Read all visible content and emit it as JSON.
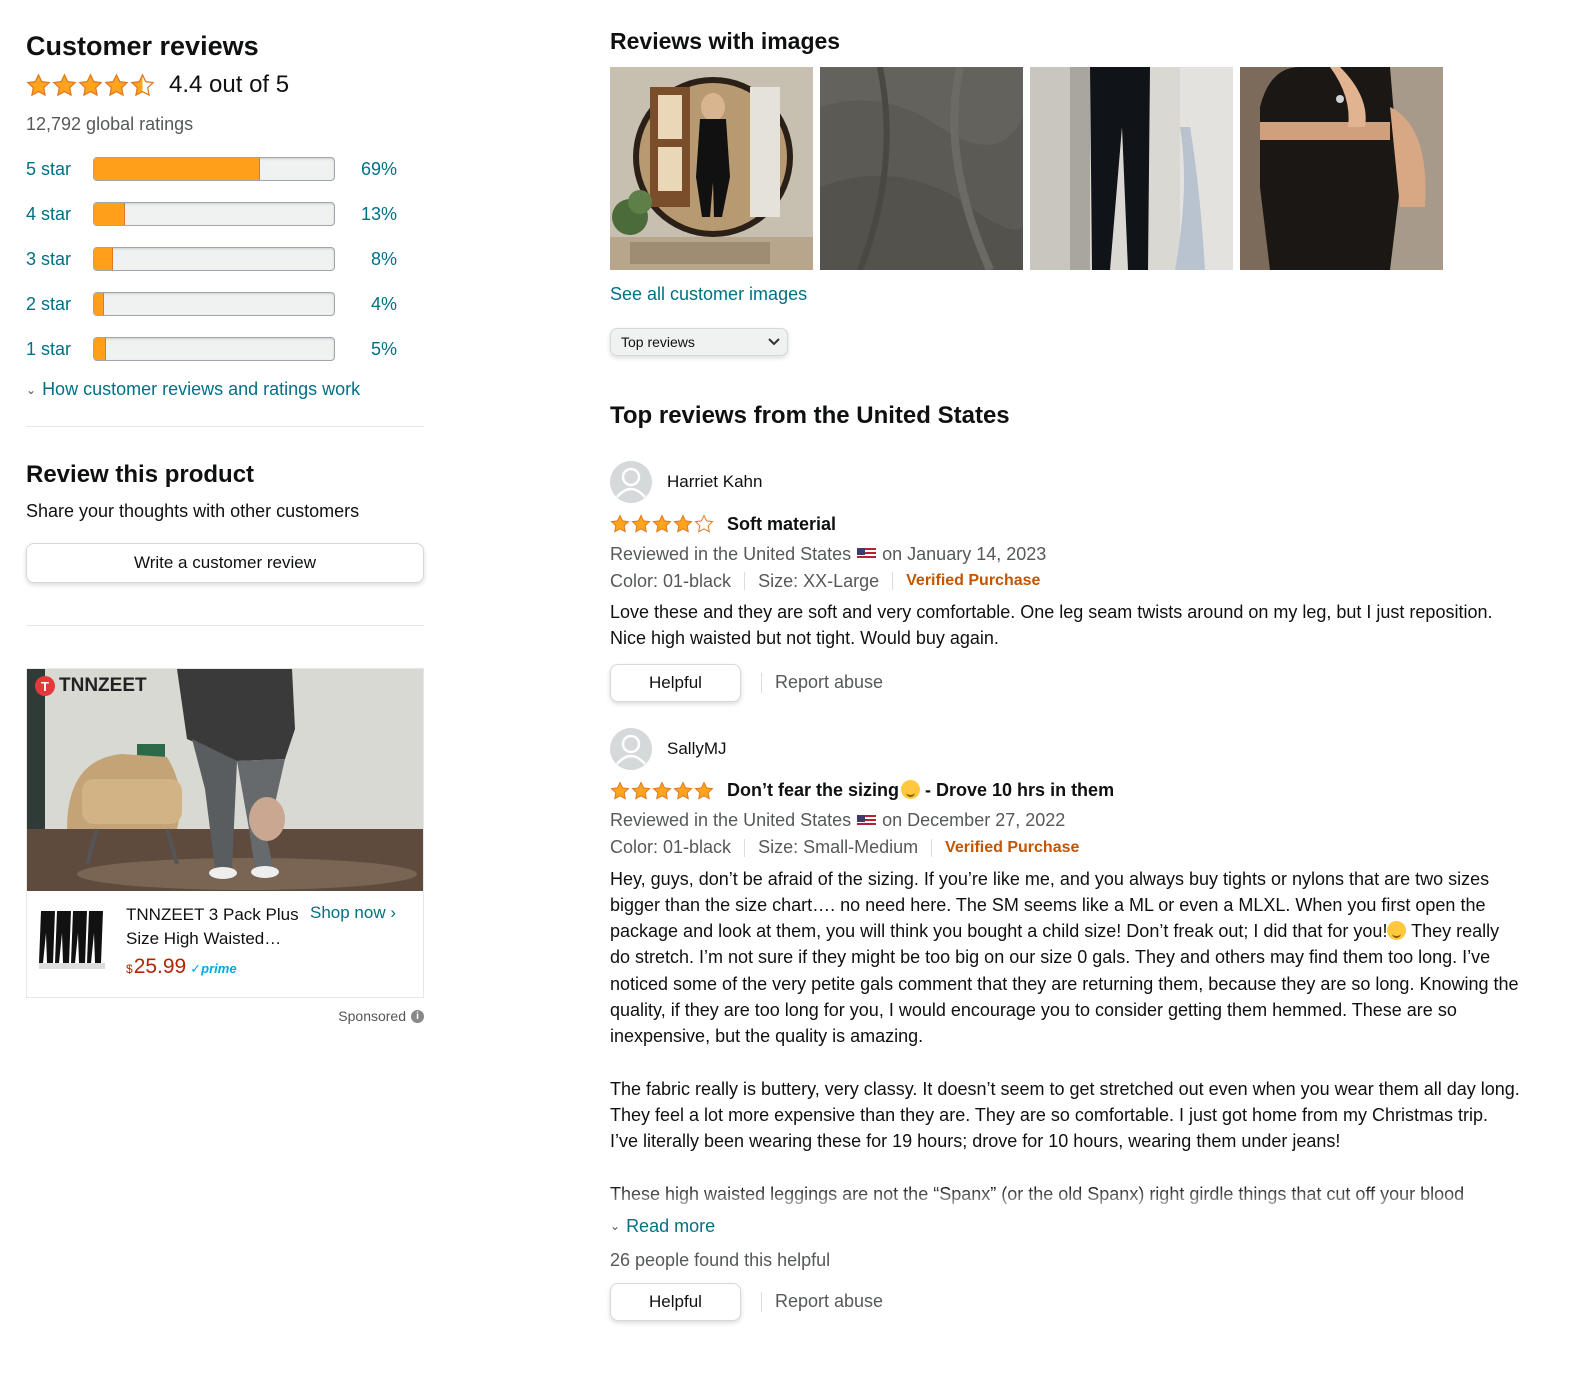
{
  "summary": {
    "heading": "Customer reviews",
    "average_text": "4.4 out of 5",
    "average_rating": 4.4,
    "global_ratings": "12,792 global ratings",
    "histogram": [
      {
        "label": "5 star",
        "pct_text": "69%",
        "pct": 69
      },
      {
        "label": "4 star",
        "pct_text": "13%",
        "pct": 13
      },
      {
        "label": "3 star",
        "pct_text": "8%",
        "pct": 8
      },
      {
        "label": "2 star",
        "pct_text": "4%",
        "pct": 4
      },
      {
        "label": "1 star",
        "pct_text": "5%",
        "pct": 5
      }
    ],
    "how_link": "How customer reviews and ratings work"
  },
  "review_this": {
    "heading": "Review this product",
    "subtext": "Share your thoughts with other customers",
    "button": "Write a customer review"
  },
  "ad": {
    "brand": "TNNZEET",
    "title": "TNNZEET 3 Pack Plus Size High Waisted…",
    "price_symbol": "$",
    "price": "25.99",
    "prime": "prime",
    "shop_now": "Shop now ›",
    "sponsored": "Sponsored"
  },
  "images_section": {
    "heading": "Reviews with images",
    "see_all": "See all customer images",
    "images": [
      "mirror-selfie-image",
      "gray-fabric-image",
      "black-leggings-image",
      "black-top-selfie-image"
    ]
  },
  "sort": {
    "selected": "Top reviews"
  },
  "top_heading": "Top reviews from the United States",
  "reviews": [
    {
      "name": "Harriet Kahn",
      "rating": 4,
      "title_part1": "Soft material",
      "title_part2": "",
      "reviewed_prefix": "Reviewed in the United States",
      "reviewed_date": "on January 14, 2023",
      "color": "Color: 01-black",
      "size": "Size: XX-Large",
      "verified": "Verified Purchase",
      "paragraphs": [
        "Love these and they are soft and very comfortable. One leg seam twists around on my leg, but I just reposition. Nice high waisted but not tight. Would buy again."
      ],
      "read_more": "",
      "found_helpful": "",
      "helpful_button": "Helpful",
      "report": "Report abuse"
    },
    {
      "name": "SallyMJ",
      "rating": 5,
      "title_part1": "Don’t fear the sizing",
      "title_part2": " - Drove 10 hrs in them",
      "reviewed_prefix": "Reviewed in the United States",
      "reviewed_date": "on December 27, 2022",
      "color": "Color: 01-black",
      "size": "Size: Small-Medium",
      "verified": "Verified Purchase",
      "paragraphs": [
        "Hey, guys, don’t be afraid of the sizing. If you’re like me, and you always buy tights or nylons that are two sizes bigger than the size chart…. no need here. The SM seems like a ML or even a MLXL. When you first open the package and look at them, you will think you bought a child size! Don’t freak out; I did that for you!😉 They really do stretch. I’m not sure if they might be too big on our size 0 gals. They and others may find them too long. I’ve noticed some of the very petite gals comment that they are returning them, because they are so long. Knowing the quality, if they are too long for you, I would encourage you to consider getting them hemmed. These are so inexpensive, but the quality is amazing.",
        "The fabric really is buttery, very classy. It doesn’t seem to get stretched out even when you wear them all day long. They feel a lot more expensive than they are. They are so comfortable. I just got home from my Christmas trip. I’ve literally been wearing these for 19 hours; drove for 10 hours, wearing them under jeans!",
        "These high waisted leggings are not the “Spanx” (or the old Spanx) right girdle things that cut off your blood pressure, where you can’t breathe. Remember those? I got the black leggings here, and pulled the"
      ],
      "read_more": "Read more",
      "found_helpful": "26 people found this helpful",
      "helpful_button": "Helpful",
      "report": "Report abuse"
    }
  ],
  "colors": {
    "star": "#ffa41c",
    "link": "#007185",
    "verified": "#c45500",
    "price": "#b12704"
  }
}
